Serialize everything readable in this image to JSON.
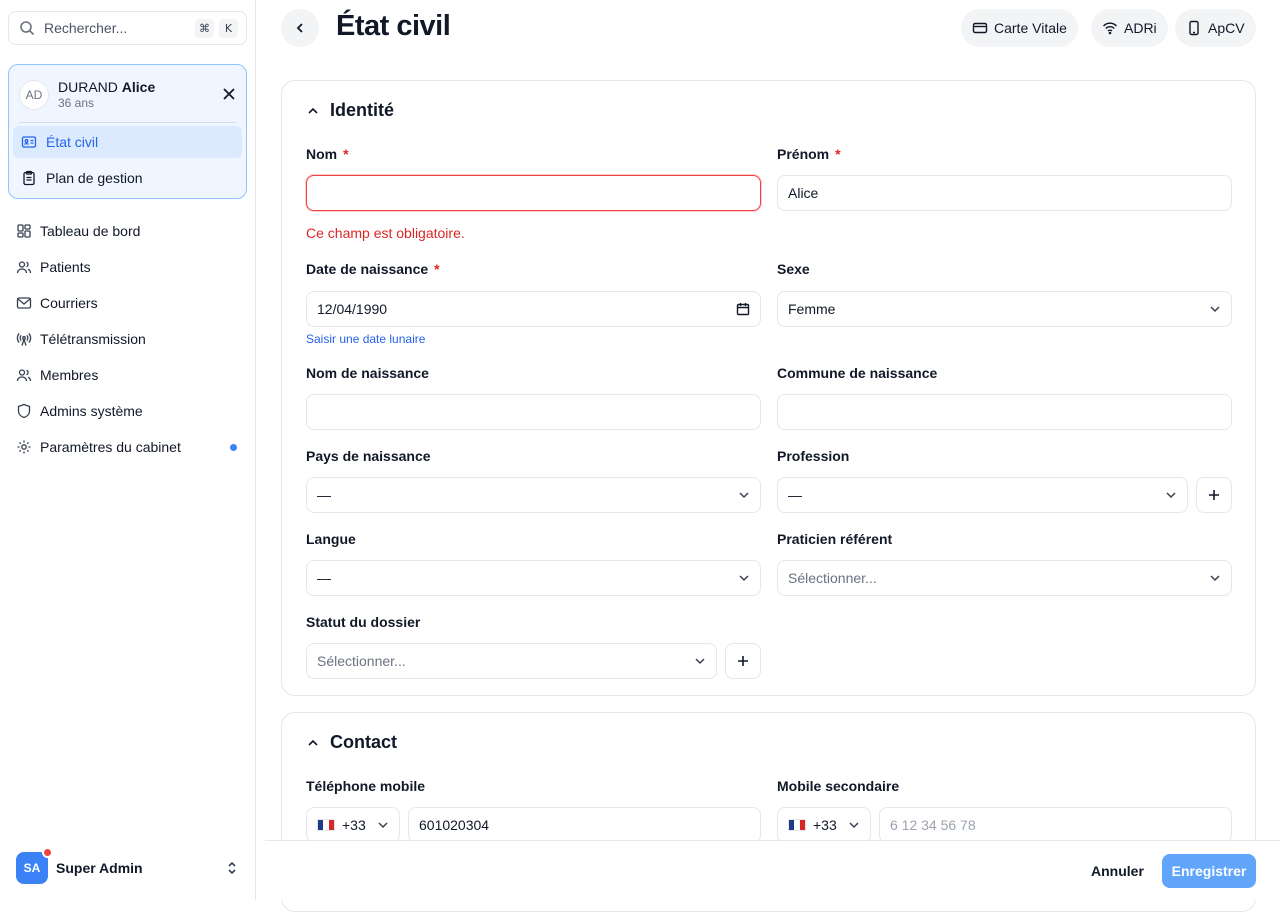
{
  "search": {
    "placeholder": "Rechercher...",
    "kbd_cmd": "⌘",
    "kbd_key": "K"
  },
  "patient": {
    "initials": "AD",
    "last_name": "DURAND",
    "first_name": "Alice",
    "age": "36 ans",
    "nav": [
      {
        "label": "État civil",
        "icon": "id-card-icon",
        "active": true
      },
      {
        "label": "Plan de gestion",
        "icon": "clipboard-icon",
        "active": false
      }
    ]
  },
  "sidebar": {
    "items": [
      {
        "label": "Tableau de bord",
        "icon": "dashboard-icon"
      },
      {
        "label": "Patients",
        "icon": "users-icon"
      },
      {
        "label": "Courriers",
        "icon": "mail-icon"
      },
      {
        "label": "Télétransmission",
        "icon": "antenna-icon"
      },
      {
        "label": "Membres",
        "icon": "members-icon"
      },
      {
        "label": "Admins système",
        "icon": "shield-icon"
      },
      {
        "label": "Paramètres du cabinet",
        "icon": "gear-icon",
        "has_dot": true
      }
    ]
  },
  "user": {
    "initials": "SA",
    "name": "Super Admin"
  },
  "header": {
    "title": "État civil",
    "buttons": [
      {
        "label": "Carte Vitale",
        "icon": "card-icon"
      },
      {
        "label": "ADRi",
        "icon": "wifi-icon"
      },
      {
        "label": "ApCV",
        "icon": "phone-icon"
      }
    ]
  },
  "identite": {
    "title": "Identité",
    "nom": {
      "label": "Nom",
      "value": "",
      "error": "Ce champ est obligatoire."
    },
    "prenom": {
      "label": "Prénom",
      "value": "Alice"
    },
    "date_naissance": {
      "label": "Date de naissance",
      "value": "12/04/1990",
      "link": "Saisir une date lunaire"
    },
    "sexe": {
      "label": "Sexe",
      "value": "Femme"
    },
    "nom_naissance": {
      "label": "Nom de naissance",
      "value": ""
    },
    "commune_naissance": {
      "label": "Commune de naissance",
      "value": ""
    },
    "pays_naissance": {
      "label": "Pays de naissance",
      "value": "—"
    },
    "profession": {
      "label": "Profession",
      "value": "—"
    },
    "langue": {
      "label": "Langue",
      "value": "—"
    },
    "praticien": {
      "label": "Praticien référent",
      "placeholder": "Sélectionner..."
    },
    "statut": {
      "label": "Statut du dossier",
      "placeholder": "Sélectionner..."
    }
  },
  "contact": {
    "title": "Contact",
    "mobile": {
      "label": "Téléphone mobile",
      "code": "+33",
      "value": "601020304"
    },
    "mobile2": {
      "label": "Mobile secondaire",
      "code": "+33",
      "placeholder": "6 12 34 56 78"
    }
  },
  "footer": {
    "cancel": "Annuler",
    "save": "Enregistrer"
  },
  "colors": {
    "accent": "#2563eb",
    "error": "#dc2626",
    "save_button": "#60a5fa",
    "flag_blue": "#1e3a8a",
    "flag_red": "#dc2626"
  }
}
